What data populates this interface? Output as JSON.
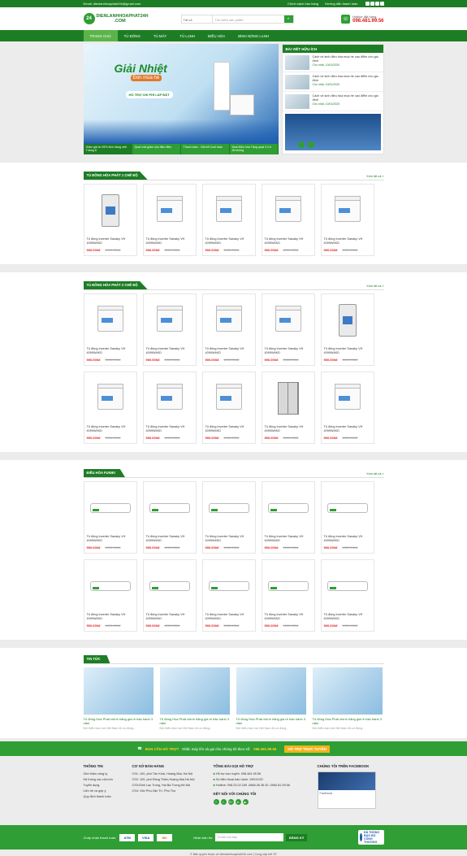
{
  "topbar": {
    "email": "Email: dienlanhhoaphat24h@gmail.com",
    "links": [
      "Chính sách bảo hàng",
      "Hướng dẫn thanh toán"
    ],
    "social_icons": [
      "facebook-icon",
      "twitter-icon",
      "google-plus-icon",
      "youtube-icon"
    ]
  },
  "header": {
    "logo_main": "DIENLANHHOAPHAT24H",
    "logo_sub": ".COM",
    "search_category": "Tất cả",
    "search_placeholder": "Tìm kiếm sản phẩm",
    "hotline_label": "Hotline đặt hàng:",
    "hotline_number": "098.481.99.56"
  },
  "nav": [
    "TRANG CHỦ",
    "TỦ ĐÔNG",
    "TỦ MÁT",
    "TỦ LẠNH",
    "ĐIỀU HÒA",
    "BÌNH NÓNG LẠNH"
  ],
  "slider": {
    "headline": "Giải Nhiệt",
    "subline": "Đón mùa hè",
    "badge": "HỖ TRỢ CHI PHÍ LẮP ĐẶT",
    "tabs": [
      "Giảm giá từ 25% đơn hàng mới Tháng 8",
      "Quạt mát giảm sốc điều điều",
      "Thanh toán - Giá tốt Cuối tuần",
      "Mua Điều hòa Tặng quạt 3.4 tr đồ không"
    ]
  },
  "sidebar": {
    "title": "BÀI VIẾT HỮU ÍCH",
    "posts": [
      {
        "title": "Cách vệ sinh điều hòa mùa hè cao điểm cho gia đình",
        "date": "Cho nhật, 10/01/2020"
      },
      {
        "title": "Cách vệ sinh điều hòa mùa hè cao điểm cho gia đình",
        "date": "Cho nhật, 10/01/2020"
      },
      {
        "title": "Cách vệ sinh điều hòa mùa hè cao điểm cho gia đình",
        "date": "Cho nhật, 10/01/2020"
      }
    ]
  },
  "sections": [
    {
      "title": "TỦ ĐÔNG HÒA PHÁT 1 CHẾ ĐỘ",
      "more": "Xem tất cả »",
      "kinds": [
        "upright",
        "chest",
        "chest",
        "chest",
        "chest"
      ]
    },
    {
      "title": "TỦ ĐÔNG HÒA PHÁT 2 CHẾ ĐỘ",
      "more": "Xem tất cả »",
      "kinds": [
        "chest",
        "chest",
        "chest",
        "chest",
        "upright",
        "chest",
        "chest",
        "chest",
        "sbs",
        "chest"
      ]
    },
    {
      "title": "ĐIỀU HÒA FUNIKI",
      "more": "Xem tất cả »",
      "kinds": [
        "ac",
        "ac",
        "ac",
        "ac",
        "ac",
        "ac",
        "ac",
        "ac",
        "ac",
        "ac"
      ]
    }
  ],
  "product": {
    "name": "Tủ đông Inverter Sanaky VH 4099W4KD",
    "price": "900.000đ",
    "old_price": "1000.000đ"
  },
  "news": {
    "title": "TIN TỨC",
    "items": [
      {
        "title": "Tủ đông Hòa Phát chính hãng giá rẻ bảo hành 3 năm",
        "desc": "Đối thiểu bạn mà Việt Nam đồ có đông..."
      },
      {
        "title": "Tủ đông Hòa Phát chính hãng giá rẻ bảo hành 3 năm",
        "desc": "Đối thiểu bạn mà Việt Nam đồ có đông..."
      },
      {
        "title": "Tủ đông Hòa Phát chính hãng giá rẻ bảo hành 3 năm",
        "desc": "Đối thiểu bạn mà Việt Nam đồ có đông..."
      },
      {
        "title": "Tủ đông Hòa Phát chính hãng giá rẻ bảo hành 3 năm",
        "desc": "Đối thiểu bạn mà Việt Nam đồ có đông..."
      }
    ]
  },
  "support": {
    "lead": "BẠN CẦN HỖ TRỢ?",
    "text": "Nhấc máy lên và gọi cho chúng tôi theo số:",
    "phone": "098.481.99.56",
    "button": "HỖ TRỢ TRỰC TUYẾN"
  },
  "footer": {
    "info_title": "THÔNG TIN",
    "info": [
      "Giới thiệu công ty",
      "Hệ thống các cửa lớn",
      "Tuyển dụng",
      "Liên hệ và góp ý",
      "Quy định thanh toán"
    ],
    "stores_title": "CƠ SỞ BÁN HÀNG",
    "stores": [
      "CS1: 100, phố Tân Khai, Hoàng Mai, Hà Nội",
      "CS2: 100, phố Đông Thiên,Hoàng Mai,Hà Nội",
      "CS3:Dĩnh Lạc Trung, Hai Bà Trưng,Hà Nội",
      "CS4: Văn Phú,Văn Trì, Phú Thọ"
    ],
    "support_title": "TỔNG ĐÀI GỌI HỖ TRỢ",
    "support": [
      "Hỗ trợ trực tuyến: 098.481.99.56",
      "Số điện thoại bảo hành: 19001022",
      "Hotline: 098.23.02.189 ,0868.36.36.30 ,0984.81.99.56"
    ],
    "connect_title": "KẾT NỐI VỚI CHÚNG TÔI",
    "connect": [
      "f",
      "t",
      "G+",
      "in",
      "▶"
    ],
    "fb_title": "CHÚNG TÔI TRÊN FACEBOOK",
    "fb_page": "Facebook"
  },
  "payment": {
    "label": "Chấp nhận thanh toán:",
    "cards": [
      "ATM",
      "VISA",
      "MC"
    ],
    "mail_label": "Nhận bản tin:",
    "mail_placeholder": "Email của bạn",
    "mail_button": "ĐĂNG KÝ",
    "bct": "ĐÃ THÔNG BÁO BỘ CÔNG THƯƠNG"
  },
  "copyright": "© Bản quyền thuộc về dienlanhhoaphat24h.com | Cung cấp bởi ST"
}
